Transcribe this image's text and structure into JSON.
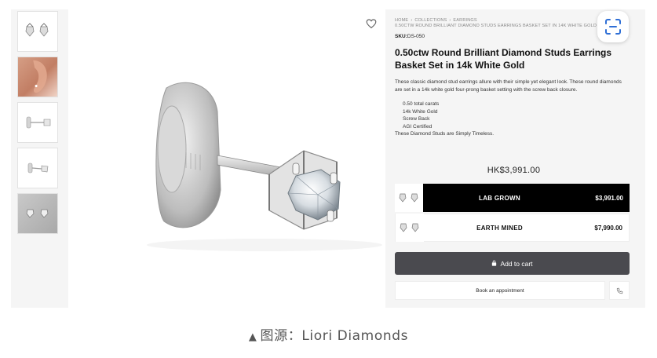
{
  "product": {
    "breadcrumb_line1": [
      "HOME",
      "COLLECTIONS",
      "EARRINGS"
    ],
    "breadcrumb_line2": "0.50CTW ROUND BRILLIANT DIAMOND STUDS EARRINGS BASKET SET IN 14K WHITE GOLD",
    "sku_label": "SKU:",
    "sku_value": "DS-050",
    "title": "0.50ctw Round Brilliant Diamond Studs Earrings Basket Set in 14k White Gold",
    "description": "These classic diamond stud earrings allure with their simple yet elegant look. These round diamonds are set in a 14k white gold four-prong basket setting with the screw back closure.",
    "features": [
      "0.50 total carats",
      "14k White Gold",
      "Screw Back",
      "AGI Certified"
    ],
    "tagline": "These Diamond Studs are Simply Timeless.",
    "price": "HK$3,991.00"
  },
  "options": [
    {
      "label": "LAB GROWN",
      "price": "$3,991.00",
      "selected": true
    },
    {
      "label": "EARTH MINED",
      "price": "$7,990.00",
      "selected": false
    }
  ],
  "actions": {
    "add_to_cart": "Add to cart",
    "book_appointment": "Book an appointment"
  },
  "thumbnails": [
    {
      "kind": "pair-of-studs"
    },
    {
      "kind": "ear-model"
    },
    {
      "kind": "side-view"
    },
    {
      "kind": "side-view-small"
    },
    {
      "kind": "grey-background"
    }
  ],
  "icons": {
    "wishlist": "heart-icon",
    "cart": "lock-icon",
    "phone": "phone-icon",
    "scan": "scan-icon"
  },
  "caption": {
    "marker": "▲",
    "text": "图源：Liori Diamonds"
  },
  "colors": {
    "selected_option_bg": "#000000",
    "add_to_cart_bg": "#4a4a4f",
    "page_bg": "#f5f5f5"
  }
}
